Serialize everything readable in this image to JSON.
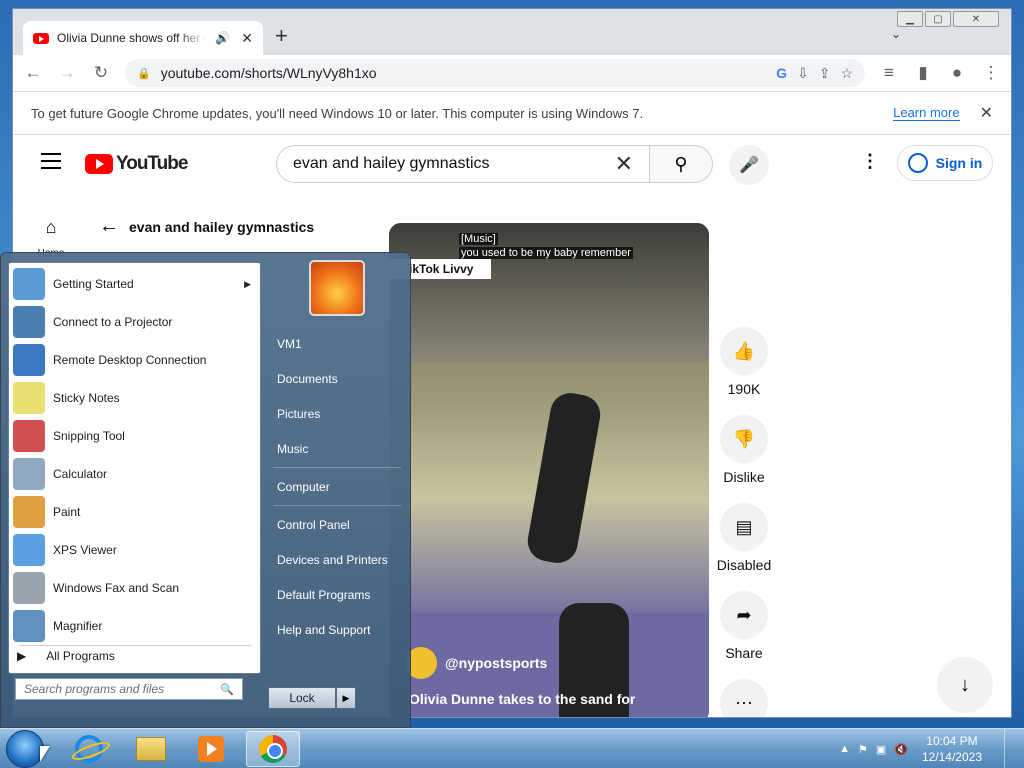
{
  "browser": {
    "tab_title": "Olivia Dunne shows off her w",
    "speaker_icon": "speaker-icon",
    "tab_close": "✕",
    "new_tab": "+",
    "tab_search": "⌄",
    "url": "youtube.com/shorts/WLnyVy8h1xo",
    "infobar_message": "To get future Google Chrome updates, you'll need Windows 10 or later. This computer is using Windows 7.",
    "infobar_link": "Learn more",
    "infobar_close": "✕"
  },
  "youtube": {
    "logo_text": "YouTube",
    "search_query": "evan and hailey gymnastics",
    "signin": "Sign in",
    "home_label": "Home",
    "back_title": "evan and hailey gymnastics",
    "video": {
      "caption_music": "[Music]",
      "caption_lyric": "you used to be my baby remember",
      "tiktok_label": "ikTok Livvy",
      "channel": "@nypostsports",
      "title": "Olivia Dunne takes to the sand for"
    },
    "actions": [
      {
        "icon": "like-icon",
        "label": "190K"
      },
      {
        "icon": "dislike-icon",
        "label": "Dislike"
      },
      {
        "icon": "comments-icon",
        "label": "Disabled"
      },
      {
        "icon": "share-icon",
        "label": "Share"
      },
      {
        "icon": "more-icon",
        "label": ""
      }
    ]
  },
  "start_menu": {
    "programs": [
      {
        "label": "Getting Started",
        "submenu": true,
        "color": "#5a9bd5"
      },
      {
        "label": "Connect to a Projector",
        "submenu": false,
        "color": "#4a7fb0"
      },
      {
        "label": "Remote Desktop Connection",
        "submenu": false,
        "color": "#3c78c0"
      },
      {
        "label": "Sticky Notes",
        "submenu": false,
        "color": "#e8e070"
      },
      {
        "label": "Snipping Tool",
        "submenu": false,
        "color": "#d05050"
      },
      {
        "label": "Calculator",
        "submenu": false,
        "color": "#90a8c0"
      },
      {
        "label": "Paint",
        "submenu": false,
        "color": "#e0a040"
      },
      {
        "label": "XPS Viewer",
        "submenu": false,
        "color": "#5aa0e0"
      },
      {
        "label": "Windows Fax and Scan",
        "submenu": false,
        "color": "#9aa4ae"
      },
      {
        "label": "Magnifier",
        "submenu": false,
        "color": "#6090c0"
      }
    ],
    "all_programs": "All Programs",
    "search_placeholder": "Search programs and files",
    "right_links": [
      "VM1",
      "Documents",
      "Pictures",
      "Music",
      "Computer",
      "Control Panel",
      "Devices and Printers",
      "Default Programs",
      "Help and Support"
    ],
    "lock_label": "Lock"
  },
  "taskbar": {
    "time": "10:04 PM",
    "date": "12/14/2023"
  }
}
